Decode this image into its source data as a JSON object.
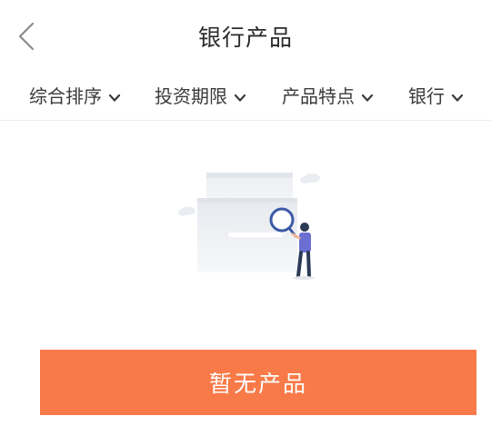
{
  "header": {
    "title": "银行产品",
    "back_icon": "chevron-left-icon"
  },
  "filters": [
    {
      "label": "综合排序",
      "icon": "chevron-down-icon"
    },
    {
      "label": "投资期限",
      "icon": "chevron-down-icon"
    },
    {
      "label": "产品特点",
      "icon": "chevron-down-icon"
    },
    {
      "label": "银行",
      "icon": "chevron-down-icon"
    }
  ],
  "empty_state": {
    "illustration": "empty-search-illustration",
    "button_label": "暂无产品"
  },
  "colors": {
    "accent": "#f77a48",
    "text": "#333333",
    "divider": "#ececec"
  }
}
